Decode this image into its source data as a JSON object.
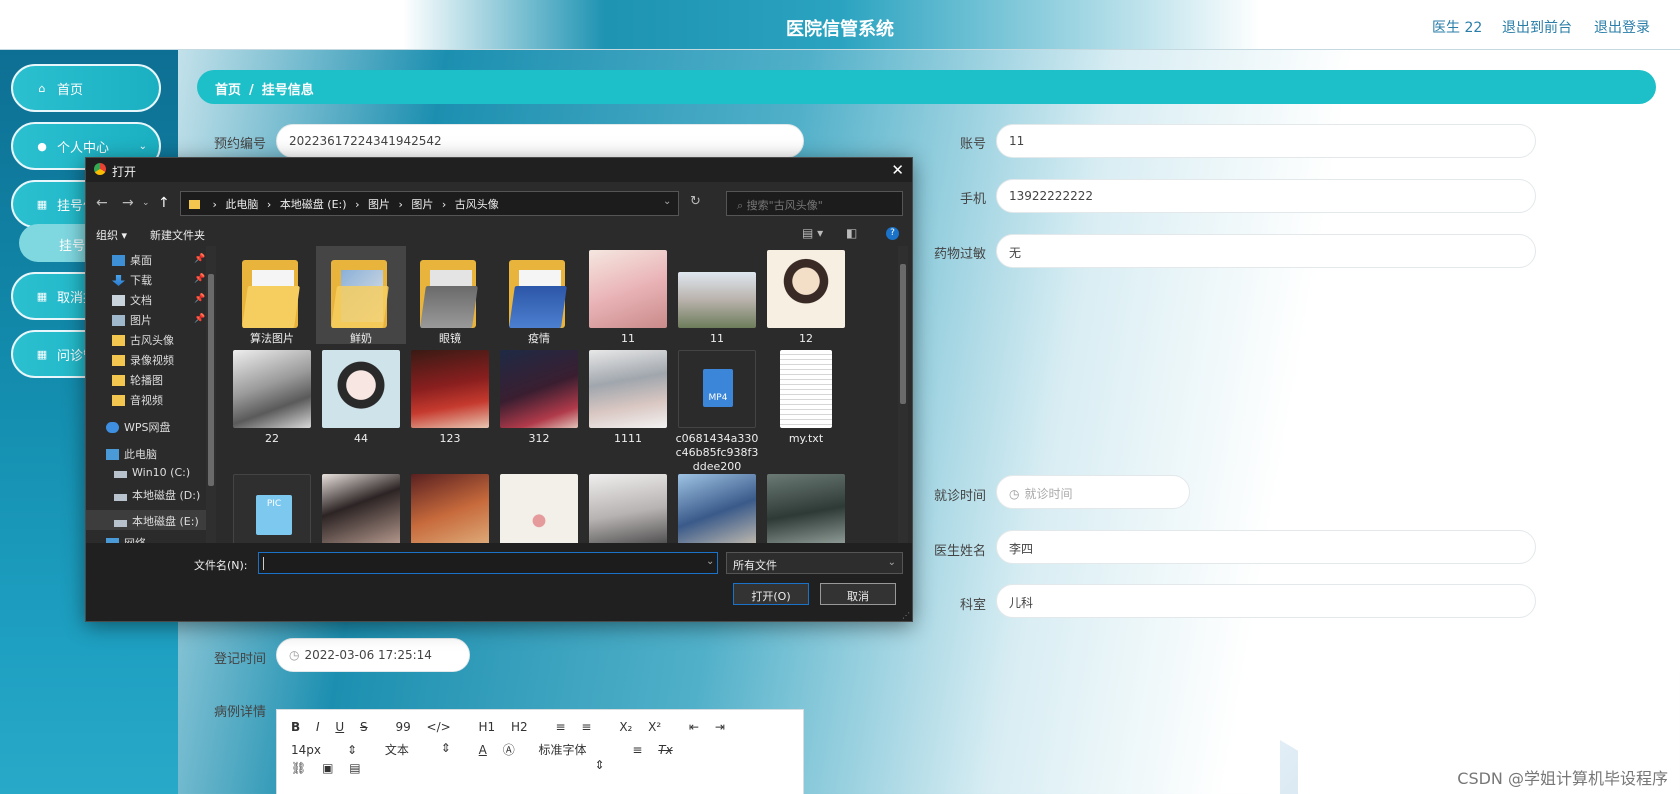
{
  "header": {
    "title": "医院信管系统",
    "user": "医生 22",
    "back_to_front": "退出到前台",
    "logout": "退出登录"
  },
  "sidebar": {
    "items": [
      {
        "label": "首页",
        "icon": "home-icon"
      },
      {
        "label": "个人中心",
        "icon": "user-icon"
      },
      {
        "label": "挂号信息",
        "icon": "grid-icon"
      },
      {
        "label": "取消挂号",
        "icon": "grid-icon"
      },
      {
        "label": "问诊管理",
        "icon": "grid-icon"
      }
    ],
    "sub_item": "挂号信息"
  },
  "breadcrumb": {
    "home": "首页",
    "separator": "/",
    "current": "挂号信息"
  },
  "form": {
    "appointment_no_label": "预约编号",
    "appointment_no": "20223617224341942542",
    "account_label": "账号",
    "account": "11",
    "phone_label": "手机",
    "phone": "13922222222",
    "allergy_label": "药物过敏",
    "allergy": "无",
    "visit_time_label": "就诊时间",
    "visit_time_placeholder": "就诊时间",
    "doctor_label": "医生姓名",
    "doctor": "李四",
    "dept_label": "科室",
    "dept": "儿科",
    "register_time_label": "登记时间",
    "register_time": "2022-03-06 17:25:14",
    "case_detail_label": "病例详情"
  },
  "editor": {
    "toolbar_row1": [
      "B",
      "I",
      "U",
      "S",
      "99",
      "</>",
      "H1",
      "H2",
      "≡",
      "≡",
      "X₂",
      "X²",
      "⇤",
      "⇥"
    ],
    "font_size": "14px",
    "text_type": "文本",
    "font_family": "标准字体",
    "align": "≡",
    "clear": "Tx"
  },
  "dialog": {
    "title": "打开",
    "path": [
      "此电脑",
      "本地磁盘 (E:)",
      "图片",
      "图片",
      "古风头像"
    ],
    "search_placeholder": "搜索\"古风头像\"",
    "organize": "组织 ▾",
    "new_folder": "新建文件夹",
    "nav_items": [
      {
        "label": "桌面",
        "icon": "desktop-icon"
      },
      {
        "label": "下载",
        "icon": "download-icon"
      },
      {
        "label": "文档",
        "icon": "document-icon"
      },
      {
        "label": "图片",
        "icon": "pictures-icon"
      },
      {
        "label": "古风头像",
        "icon": "folder-icon"
      },
      {
        "label": "录像视频",
        "icon": "folder-icon"
      },
      {
        "label": "轮播图",
        "icon": "folder-icon"
      },
      {
        "label": "音视频",
        "icon": "folder-icon"
      },
      {
        "label": "WPS网盘",
        "icon": "cloud-icon"
      },
      {
        "label": "此电脑",
        "icon": "computer-icon"
      },
      {
        "label": "Win10 (C:)",
        "icon": "drive-icon"
      },
      {
        "label": "本地磁盘 (D:)",
        "icon": "drive-icon"
      },
      {
        "label": "本地磁盘 (E:)",
        "icon": "drive-icon"
      },
      {
        "label": "网络",
        "icon": "network-icon"
      }
    ],
    "files": [
      {
        "name": "算法图片",
        "kind": "folder"
      },
      {
        "name": "鲜奶",
        "kind": "folder"
      },
      {
        "name": "眼镜",
        "kind": "folder"
      },
      {
        "name": "疫情",
        "kind": "folder"
      },
      {
        "name": "11",
        "kind": "image"
      },
      {
        "name": "11",
        "kind": "image"
      },
      {
        "name": "12",
        "kind": "image"
      },
      {
        "name": "22",
        "kind": "image"
      },
      {
        "name": "44",
        "kind": "image"
      },
      {
        "name": "123",
        "kind": "image"
      },
      {
        "name": "312",
        "kind": "image"
      },
      {
        "name": "1111",
        "kind": "image"
      },
      {
        "name": "c0681434a330c46b85fc938f3ddee200",
        "kind": "video"
      },
      {
        "name": "my.txt",
        "kind": "text"
      }
    ],
    "mp4_label": "MP4",
    "pic_label": "PIC",
    "filename_label": "文件名(N):",
    "filename_value": "",
    "filter": "所有文件",
    "open_button": "打开(O)",
    "cancel_button": "取消"
  },
  "watermark": "CSDN @学姐计算机毕设程序",
  "colors": {
    "accent": "#1dbfc9",
    "sidebar": "#128aab",
    "header_link": "#2a7ea8"
  }
}
